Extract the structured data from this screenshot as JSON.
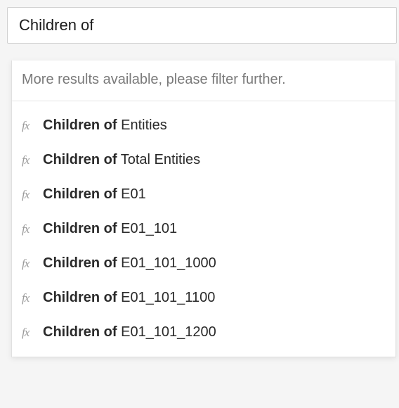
{
  "search": {
    "value": "Children of"
  },
  "dropdown": {
    "info_message": "More results available, please filter further.",
    "fx_label": "fx",
    "items": [
      {
        "prefix": "Children of",
        "suffix": " Entities"
      },
      {
        "prefix": "Children of",
        "suffix": " Total Entities"
      },
      {
        "prefix": "Children of",
        "suffix": " E01"
      },
      {
        "prefix": "Children of",
        "suffix": " E01_101"
      },
      {
        "prefix": "Children of",
        "suffix": " E01_101_1000"
      },
      {
        "prefix": "Children of",
        "suffix": " E01_101_1100"
      },
      {
        "prefix": "Children of",
        "suffix": " E01_101_1200"
      }
    ]
  }
}
